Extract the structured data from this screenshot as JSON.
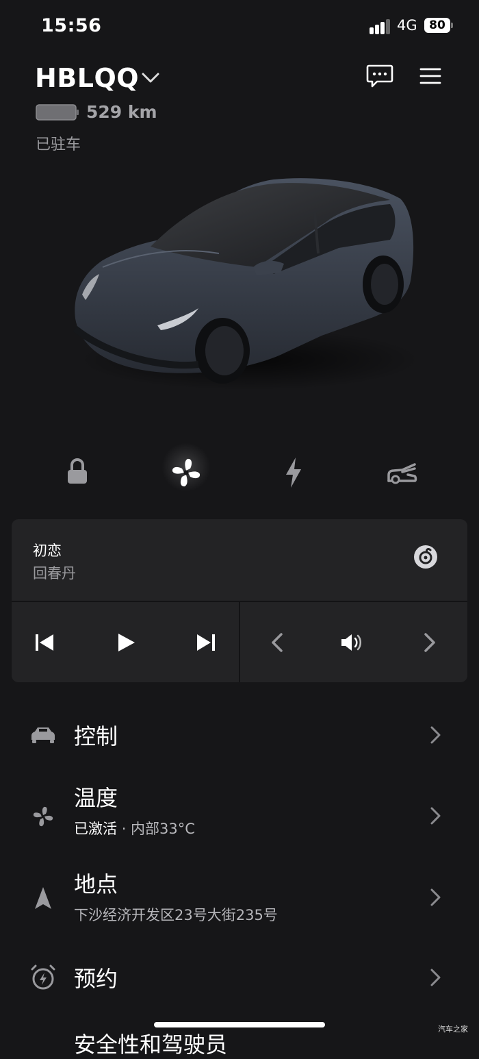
{
  "status_bar": {
    "time": "15:56",
    "network": "4G",
    "battery": "80"
  },
  "vehicle": {
    "name": "HBLQQ",
    "range": "529 km",
    "state": "已驻车"
  },
  "icons": {
    "lock": "lock-icon",
    "climate": "fan-icon",
    "charge": "bolt-icon",
    "trunk": "trunk-icon",
    "message": "message-icon",
    "menu": "menu-icon"
  },
  "media": {
    "song": "初恋",
    "artist": "回春丹",
    "source": "netease-music-icon"
  },
  "menu": {
    "controls": {
      "title": "控制"
    },
    "climate": {
      "title": "温度",
      "status": "已激活",
      "detail": "· 内部33°C"
    },
    "location": {
      "title": "地点",
      "address": "下沙经济开发区23号大街235号"
    },
    "schedule": {
      "title": "预约"
    },
    "next_partial": {
      "title": "安全性和驾驶员"
    }
  },
  "watermark": "汽车之家",
  "colors": {
    "background": "#161618",
    "card": "#232325",
    "muted": "#9a9a9e"
  }
}
